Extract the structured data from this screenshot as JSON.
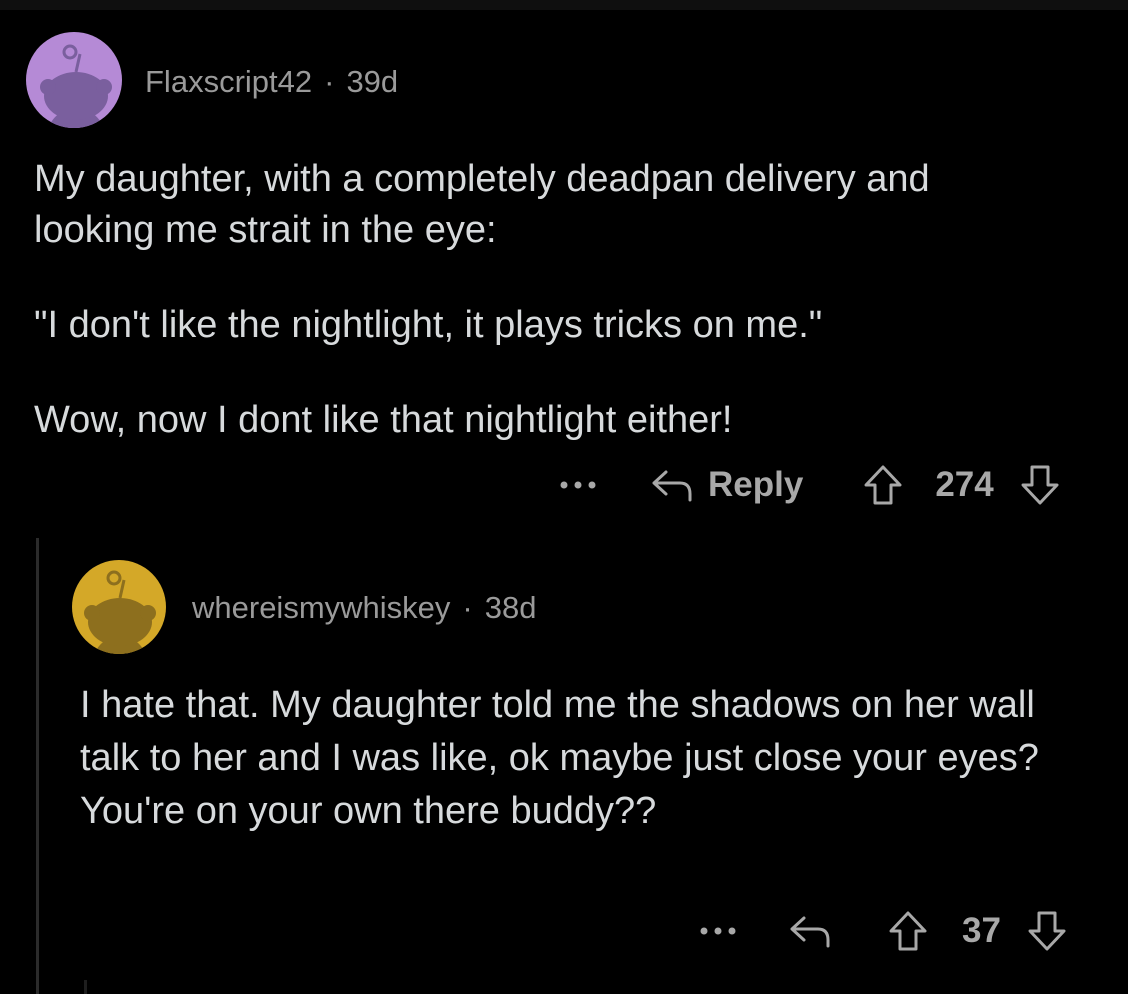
{
  "comments": [
    {
      "username": "Flaxscript42",
      "separator": "·",
      "age": "39d",
      "avatar_color": "#b58ad6",
      "paragraphs": [
        "My daughter, with a completely deadpan delivery and looking me strait in the eye:",
        "\"I don't like the nightlight, it plays tricks on me.\"",
        "Wow, now I dont like that nightlight either!"
      ],
      "more_label": "···",
      "reply_label": "Reply",
      "score": "274",
      "icons": {
        "avatar": "reddit-snoo-icon",
        "more": "more-options-icon",
        "reply": "reply-arrow-icon",
        "upvote": "upvote-arrow-icon",
        "downvote": "downvote-arrow-icon"
      }
    },
    {
      "username": "whereismywhiskey",
      "separator": "·",
      "age": "38d",
      "avatar_color": "#d4a828",
      "paragraphs": [
        "I hate that. My daughter told me the shadows on her wall talk to her and I was like, ok maybe just close your eyes? You're on your own there buddy??"
      ],
      "more_label": "···",
      "score": "37",
      "icons": {
        "avatar": "reddit-snoo-icon",
        "more": "more-options-icon",
        "reply": "reply-arrow-icon",
        "upvote": "upvote-arrow-icon",
        "downvote": "downvote-arrow-icon"
      }
    }
  ],
  "colors": {
    "background": "#000000",
    "text": "#d7dadc",
    "muted": "#9a9a9a",
    "thread_line": "#2b2b2b"
  }
}
